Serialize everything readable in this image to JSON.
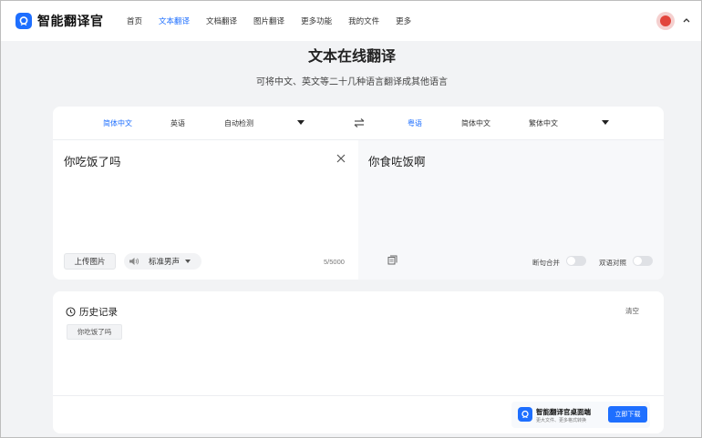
{
  "app": {
    "name": "智能翻译官"
  },
  "nav": {
    "items": [
      {
        "label": "首页"
      },
      {
        "label": "文本翻译",
        "active": true
      },
      {
        "label": "文档翻译"
      },
      {
        "label": "图片翻译"
      },
      {
        "label": "更多功能"
      },
      {
        "label": "我的文件"
      },
      {
        "label": "更多"
      }
    ]
  },
  "page": {
    "title": "文本在线翻译",
    "subtitle": "可将中文、英文等二十几种语言翻译成其他语言"
  },
  "translator": {
    "source_langs": [
      "简体中文",
      "英语",
      "自动检测"
    ],
    "target_langs": [
      "粤语",
      "简体中文",
      "繁体中文"
    ],
    "source_text": "你吃饭了吗",
    "target_text": "你食咗饭啊",
    "upload_label": "上传图片",
    "voice_label": "标准男声",
    "char_count": "5/5000",
    "options": {
      "sentence_merge": "断句合并",
      "bilingual": "双语对照"
    }
  },
  "history": {
    "title": "历史记录",
    "clear_label": "清空",
    "items": [
      "你吃饭了吗"
    ]
  },
  "promo": {
    "title": "智能翻译官桌面端",
    "subtitle": "更大文件、更多格式转换",
    "button": "立即下载"
  },
  "colors": {
    "accent": "#1e6fff",
    "background": "#f2f3f5"
  },
  "icons": [
    "logo-icon",
    "avatar-icon",
    "chevron-up-icon",
    "swap-icon",
    "close-icon",
    "speaker-icon",
    "copy-icon",
    "clock-icon"
  ]
}
